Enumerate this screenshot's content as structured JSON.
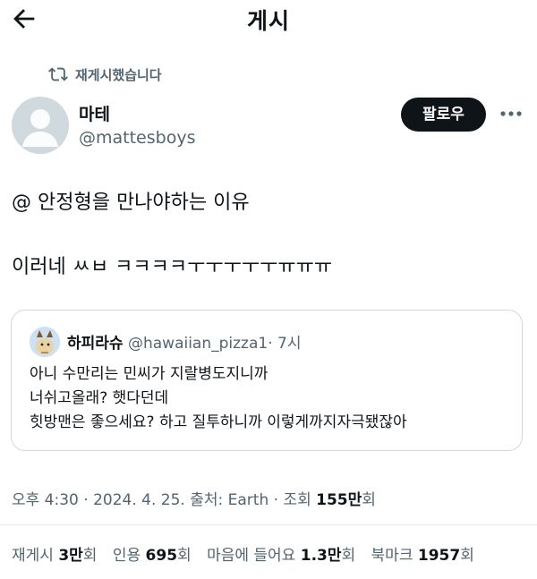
{
  "header": {
    "title": "게시"
  },
  "repost": {
    "label": "재게시했습니다"
  },
  "author": {
    "name": "마테",
    "handle": "@mattesboys"
  },
  "follow_label": "팔로우",
  "tweet": {
    "line1": "@ 안정형을 만나야하는 이유",
    "line2": "이러네 ㅆㅂ ㅋㅋㅋㅋㅜㅜㅜㅜㅜㅠㅠㅠ"
  },
  "quote": {
    "name": "하피라슈",
    "handle": "@hawaiian_pizza1",
    "time": "· 7시",
    "lines": [
      "아니 수만리는 민씨가 지랄병도지니까",
      "너쉬고올래? 햇다던데",
      "힛방맨은 좋으세요? 하고 질투하니까 이렇게까지자극됐잖아"
    ]
  },
  "meta": {
    "time": "오후 4:30",
    "date": "2024. 4. 25.",
    "source_label": "출처:",
    "source": "Earth",
    "views_label": "조회",
    "views_value": "155만",
    "views_suffix": "회"
  },
  "stats": {
    "reposts": {
      "label": "재게시",
      "value": "3만",
      "suffix": "회"
    },
    "quotes": {
      "label": "인용",
      "value": "695",
      "suffix": "회"
    },
    "likes": {
      "label": "마음에 들어요",
      "value": "1.3만",
      "suffix": "회"
    },
    "bookmarks": {
      "label": "북마크",
      "value": "1957",
      "suffix": "회"
    }
  }
}
